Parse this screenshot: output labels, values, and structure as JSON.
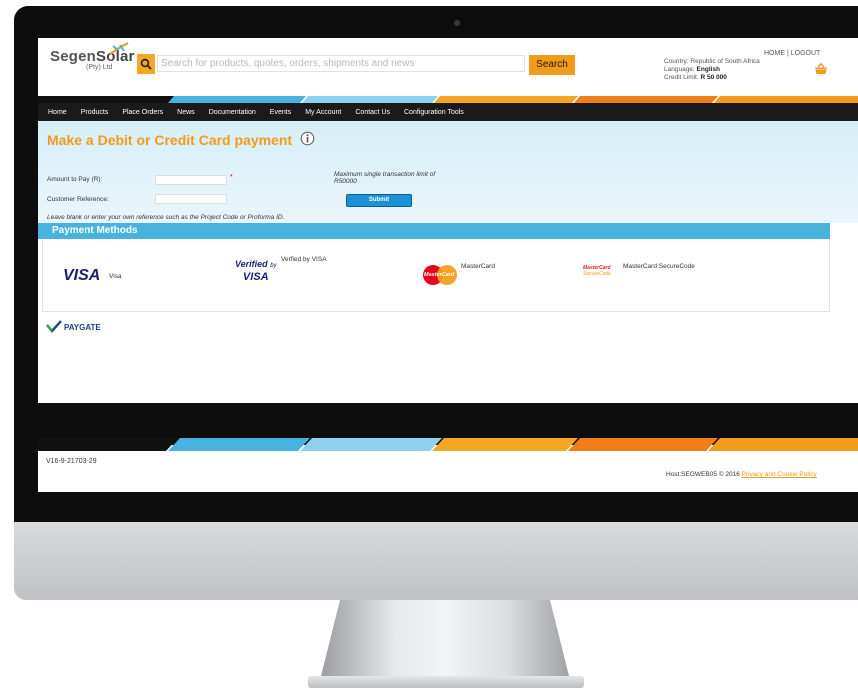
{
  "brand": {
    "name_part1": "Segen",
    "name_part2": "Solar",
    "sub": "(Pty) Ltd"
  },
  "search": {
    "placeholder": "Search for products, quotes, orders, shipments and news",
    "button_label": "Search"
  },
  "header_links": {
    "home": "HOME",
    "separator": "|",
    "logout": "LOGOUT"
  },
  "account": {
    "country_label": "Country:",
    "country_value": "Republic of South Africa",
    "language_label": "Language:",
    "language_value": "English",
    "credit_label": "Credit Limit:",
    "credit_value": "R 50 000"
  },
  "nav": [
    "Home",
    "Products",
    "Place Orders",
    "News",
    "Documentation",
    "Events",
    "My Account",
    "Contact Us",
    "Configuration Tools"
  ],
  "payment_form": {
    "title": "Make a Debit or Credit Card payment",
    "amount_label": "Amount to Pay (R):",
    "amount_value": "",
    "required_marker": "*",
    "reference_label": "Customer Reference:",
    "reference_value": "",
    "max_note_line1": "Maximum single transaction limit of",
    "max_note_line2": "R50000",
    "submit_label": "Submit",
    "leave_note": "Leave blank or enter your own reference such as the Project Code or Proforma ID."
  },
  "payment_methods": {
    "heading": "Payment Methods",
    "visa_logo": "VISA",
    "visa_label": "Visa",
    "vbv_logo_line1": "Verified",
    "vbv_logo_by": "by",
    "vbv_logo_line2": "VISA",
    "vbv_label": "Verfied by VISA",
    "mastercard_logo": "MasterCard",
    "mastercard_label": "MasterCard",
    "mcsc_logo_line1": "MasterCard",
    "mcsc_logo_line2": "SecureCode",
    "mcsc_label": "MasterCard SecureCode"
  },
  "paygate": {
    "label": "PAYGATE"
  },
  "footer": {
    "version": "V16-9-21703-29",
    "host": "Host:SEGWEB05",
    "copyright": "© 2016",
    "policy_link": "Privacy and Cookie Policy"
  },
  "colors": {
    "accent_orange": "#f29a1a",
    "accent_blue": "#49b3e0",
    "nav_bg": "#1a1a1a"
  },
  "icons": [
    "search-icon",
    "info-icon",
    "basket-icon",
    "paygate-check-icon",
    "solar-logo-icon"
  ]
}
